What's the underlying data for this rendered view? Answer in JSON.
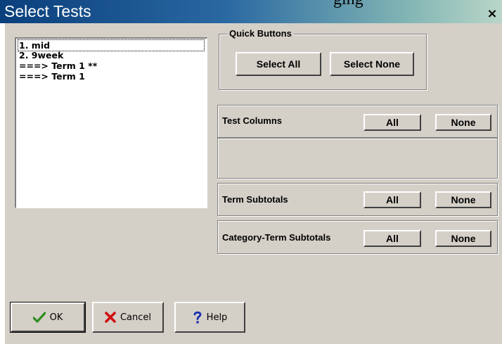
{
  "window": {
    "title": "Select Tests",
    "close_label": "×",
    "background_text": "ging"
  },
  "test_list": {
    "items": [
      "1. mid",
      "2. 9week",
      "===> Term 1 **",
      "===> Term 1"
    ]
  },
  "quick_buttons": {
    "label": "Quick Buttons",
    "select_all": "Select All",
    "select_none": "Select None"
  },
  "test_columns": {
    "label": "Test Columns",
    "all": "All",
    "none": "None"
  },
  "term_subtotals": {
    "label": "Term Subtotals",
    "all": "All",
    "none": "None"
  },
  "category_term_subtotals": {
    "label": "Category-Term Subtotals",
    "all": "All",
    "none": "None"
  },
  "footer": {
    "ok": "OK",
    "cancel": "Cancel",
    "help": "Help"
  },
  "colors": {
    "dialog_bg": "#d4d0c8",
    "title_start": "#0a3f7c",
    "title_end": "#b9d6c8",
    "ok_check": "#2e8b1e",
    "cancel_x": "#d01010",
    "help_q": "#1a2fb0"
  },
  "icons": {
    "ok": "checkmark-icon",
    "cancel": "x-icon",
    "help": "question-icon"
  }
}
